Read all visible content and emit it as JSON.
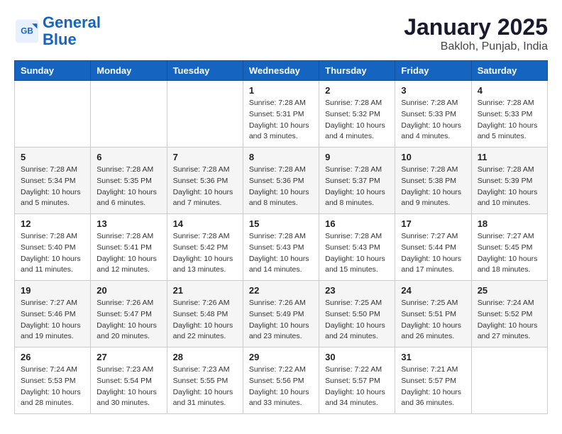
{
  "header": {
    "logo_line1": "General",
    "logo_line2": "Blue",
    "month": "January 2025",
    "location": "Bakloh, Punjab, India"
  },
  "weekdays": [
    "Sunday",
    "Monday",
    "Tuesday",
    "Wednesday",
    "Thursday",
    "Friday",
    "Saturday"
  ],
  "weeks": [
    [
      {
        "day": "",
        "info": ""
      },
      {
        "day": "",
        "info": ""
      },
      {
        "day": "",
        "info": ""
      },
      {
        "day": "1",
        "info": "Sunrise: 7:28 AM\nSunset: 5:31 PM\nDaylight: 10 hours\nand 3 minutes."
      },
      {
        "day": "2",
        "info": "Sunrise: 7:28 AM\nSunset: 5:32 PM\nDaylight: 10 hours\nand 4 minutes."
      },
      {
        "day": "3",
        "info": "Sunrise: 7:28 AM\nSunset: 5:33 PM\nDaylight: 10 hours\nand 4 minutes."
      },
      {
        "day": "4",
        "info": "Sunrise: 7:28 AM\nSunset: 5:33 PM\nDaylight: 10 hours\nand 5 minutes."
      }
    ],
    [
      {
        "day": "5",
        "info": "Sunrise: 7:28 AM\nSunset: 5:34 PM\nDaylight: 10 hours\nand 5 minutes."
      },
      {
        "day": "6",
        "info": "Sunrise: 7:28 AM\nSunset: 5:35 PM\nDaylight: 10 hours\nand 6 minutes."
      },
      {
        "day": "7",
        "info": "Sunrise: 7:28 AM\nSunset: 5:36 PM\nDaylight: 10 hours\nand 7 minutes."
      },
      {
        "day": "8",
        "info": "Sunrise: 7:28 AM\nSunset: 5:36 PM\nDaylight: 10 hours\nand 8 minutes."
      },
      {
        "day": "9",
        "info": "Sunrise: 7:28 AM\nSunset: 5:37 PM\nDaylight: 10 hours\nand 8 minutes."
      },
      {
        "day": "10",
        "info": "Sunrise: 7:28 AM\nSunset: 5:38 PM\nDaylight: 10 hours\nand 9 minutes."
      },
      {
        "day": "11",
        "info": "Sunrise: 7:28 AM\nSunset: 5:39 PM\nDaylight: 10 hours\nand 10 minutes."
      }
    ],
    [
      {
        "day": "12",
        "info": "Sunrise: 7:28 AM\nSunset: 5:40 PM\nDaylight: 10 hours\nand 11 minutes."
      },
      {
        "day": "13",
        "info": "Sunrise: 7:28 AM\nSunset: 5:41 PM\nDaylight: 10 hours\nand 12 minutes."
      },
      {
        "day": "14",
        "info": "Sunrise: 7:28 AM\nSunset: 5:42 PM\nDaylight: 10 hours\nand 13 minutes."
      },
      {
        "day": "15",
        "info": "Sunrise: 7:28 AM\nSunset: 5:43 PM\nDaylight: 10 hours\nand 14 minutes."
      },
      {
        "day": "16",
        "info": "Sunrise: 7:28 AM\nSunset: 5:43 PM\nDaylight: 10 hours\nand 15 minutes."
      },
      {
        "day": "17",
        "info": "Sunrise: 7:27 AM\nSunset: 5:44 PM\nDaylight: 10 hours\nand 17 minutes."
      },
      {
        "day": "18",
        "info": "Sunrise: 7:27 AM\nSunset: 5:45 PM\nDaylight: 10 hours\nand 18 minutes."
      }
    ],
    [
      {
        "day": "19",
        "info": "Sunrise: 7:27 AM\nSunset: 5:46 PM\nDaylight: 10 hours\nand 19 minutes."
      },
      {
        "day": "20",
        "info": "Sunrise: 7:26 AM\nSunset: 5:47 PM\nDaylight: 10 hours\nand 20 minutes."
      },
      {
        "day": "21",
        "info": "Sunrise: 7:26 AM\nSunset: 5:48 PM\nDaylight: 10 hours\nand 22 minutes."
      },
      {
        "day": "22",
        "info": "Sunrise: 7:26 AM\nSunset: 5:49 PM\nDaylight: 10 hours\nand 23 minutes."
      },
      {
        "day": "23",
        "info": "Sunrise: 7:25 AM\nSunset: 5:50 PM\nDaylight: 10 hours\nand 24 minutes."
      },
      {
        "day": "24",
        "info": "Sunrise: 7:25 AM\nSunset: 5:51 PM\nDaylight: 10 hours\nand 26 minutes."
      },
      {
        "day": "25",
        "info": "Sunrise: 7:24 AM\nSunset: 5:52 PM\nDaylight: 10 hours\nand 27 minutes."
      }
    ],
    [
      {
        "day": "26",
        "info": "Sunrise: 7:24 AM\nSunset: 5:53 PM\nDaylight: 10 hours\nand 28 minutes."
      },
      {
        "day": "27",
        "info": "Sunrise: 7:23 AM\nSunset: 5:54 PM\nDaylight: 10 hours\nand 30 minutes."
      },
      {
        "day": "28",
        "info": "Sunrise: 7:23 AM\nSunset: 5:55 PM\nDaylight: 10 hours\nand 31 minutes."
      },
      {
        "day": "29",
        "info": "Sunrise: 7:22 AM\nSunset: 5:56 PM\nDaylight: 10 hours\nand 33 minutes."
      },
      {
        "day": "30",
        "info": "Sunrise: 7:22 AM\nSunset: 5:57 PM\nDaylight: 10 hours\nand 34 minutes."
      },
      {
        "day": "31",
        "info": "Sunrise: 7:21 AM\nSunset: 5:57 PM\nDaylight: 10 hours\nand 36 minutes."
      },
      {
        "day": "",
        "info": ""
      }
    ]
  ]
}
